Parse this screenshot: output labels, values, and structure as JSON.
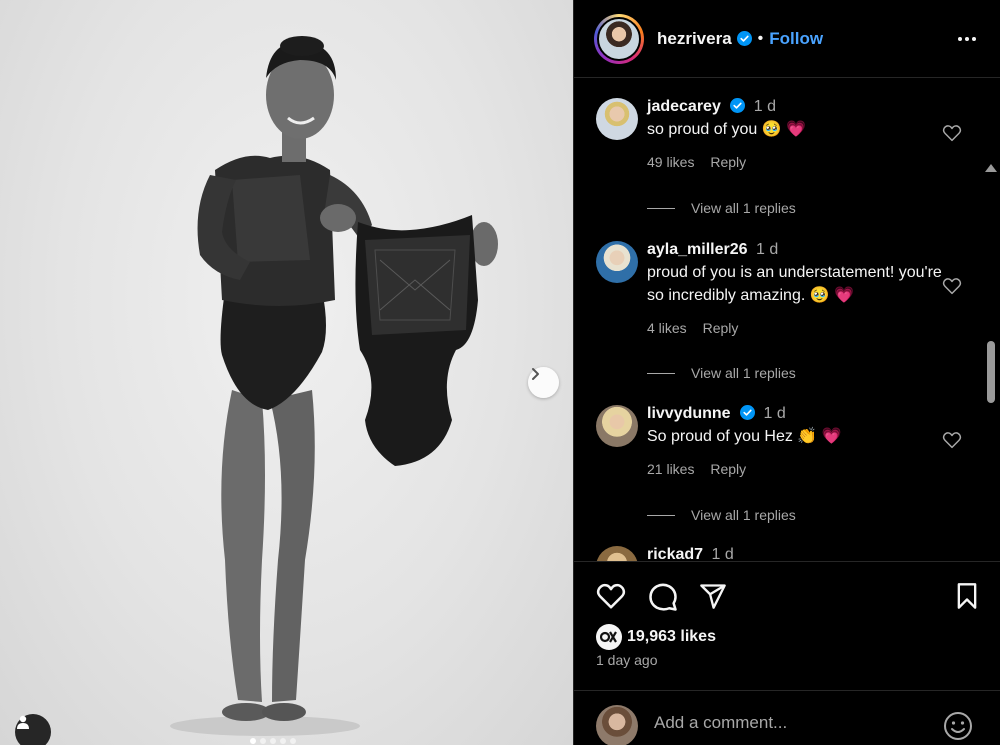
{
  "header": {
    "username": "hezrivera",
    "separator": "•",
    "follow_label": "Follow"
  },
  "comments": [
    {
      "username": "jadecarey",
      "verified": true,
      "time": "1 d",
      "text": "so proud of you 🥹 💗",
      "likes": "49 likes",
      "reply_label": "Reply",
      "view_replies": "View all 1 replies"
    },
    {
      "username": "ayla_miller26",
      "verified": false,
      "time": "1 d",
      "text": "proud of you is an understatement! you're so incredibly amazing. 🥹 💗",
      "likes": "4 likes",
      "reply_label": "Reply",
      "view_replies": "View all 1 replies"
    },
    {
      "username": "livvydunne",
      "verified": true,
      "time": "1 d",
      "text": "So proud of you Hez 👏 💗",
      "likes": "21 likes",
      "reply_label": "Reply",
      "view_replies": "View all 1 replies"
    },
    {
      "username": "rickad7",
      "verified": false,
      "time": "1 d"
    }
  ],
  "post": {
    "likes": "19,963 likes",
    "time_ago": "1 day ago"
  },
  "add_comment": {
    "placeholder": "Add a comment..."
  },
  "icons": {
    "more": "more-horizontal-icon",
    "like": "heart-icon",
    "comment": "speech-bubble-icon",
    "share": "paper-plane-icon",
    "save": "bookmark-icon",
    "next": "chevron-right-icon",
    "tag": "user-tag-icon",
    "emoji": "smiley-icon"
  },
  "colors": {
    "background": "#000000",
    "link": "#4aa3ff",
    "secondary_text": "#a8a8a8",
    "verified": "#0095f6",
    "heart": "#ff3b6b"
  }
}
